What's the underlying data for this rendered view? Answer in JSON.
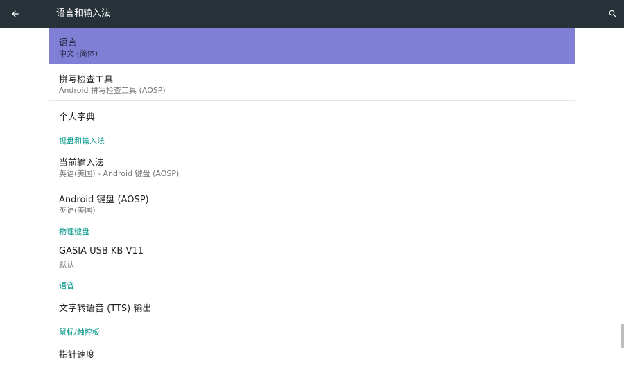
{
  "header": {
    "title": "语言和输入法",
    "back_icon": "arrow-back-icon",
    "search_icon": "search-icon",
    "background_color": "#263238"
  },
  "accent_color": "#009688",
  "selected_color": "#7f7fd5",
  "items": {
    "language": {
      "title": "语言",
      "subtitle": "中文 (简体)"
    },
    "spell_checker": {
      "title": "拼写检查工具",
      "subtitle": "Android 拼写检查工具 (AOSP)"
    },
    "personal_dictionary": {
      "title": "个人字典"
    },
    "keyboard_category": "键盘和输入法",
    "current_keyboard": {
      "title": "当前输入法",
      "subtitle": "英语(美国) - Android 键盘 (AOSP)"
    },
    "android_keyboard": {
      "title": "Android 键盘 (AOSP)",
      "subtitle": "英语(美国)"
    },
    "physical_keyboard_category": "物理键盘",
    "gasia_keyboard": {
      "title": "GASIA USB KB V11",
      "subtitle": "默认"
    },
    "speech_category": "语音",
    "tts_output": {
      "title": "文字转语音 (TTS) 输出"
    },
    "mouse_category": "鼠标/触控板",
    "pointer_speed": {
      "title": "指针速度"
    }
  }
}
